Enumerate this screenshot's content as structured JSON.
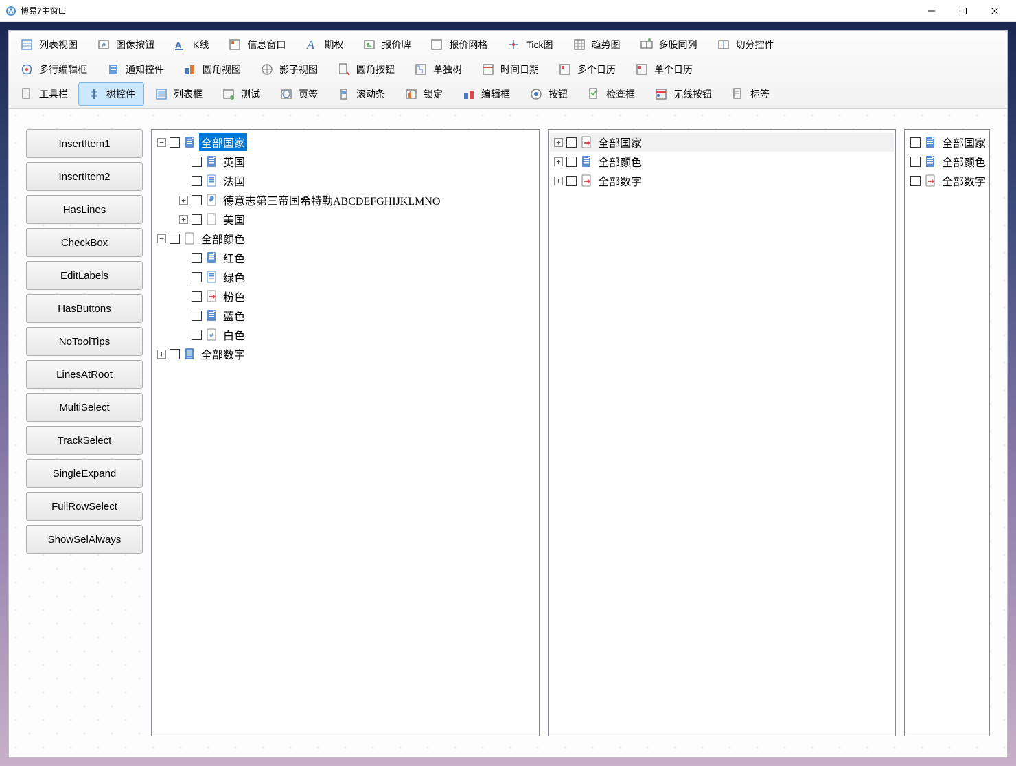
{
  "window": {
    "title": "博易7主窗口"
  },
  "toolbar_rows": [
    [
      "列表视图",
      "图像按钮",
      "K线",
      "信息窗口",
      "期权",
      "报价牌",
      "报价网格",
      "Tick图",
      "趋势图",
      "多股同列",
      "切分控件"
    ],
    [
      "多行编辑框",
      "通知控件",
      "圆角视图",
      "影子视图",
      "圆角按钮",
      "单独树",
      "时间日期",
      "多个日历",
      "单个日历"
    ],
    [
      "工具栏",
      "树控件",
      "列表框",
      "测试",
      "页签",
      "滚动条",
      "锁定",
      "编辑框",
      "按钮",
      "检查框",
      "无线按钮",
      "标签"
    ]
  ],
  "toolbar_active": "树控件",
  "side_buttons": [
    "InsertItem1",
    "InsertItem2",
    "HasLines",
    "CheckBox",
    "EditLabels",
    "HasButtons",
    "NoToolTips",
    "LinesAtRoot",
    "MultiSelect",
    "TrackSelect",
    "SingleExpand",
    "FullRowSelect",
    "ShowSelAlways"
  ],
  "tree1": [
    {
      "depth": 0,
      "exp": "-",
      "icon": "blue-doc",
      "label": "全部国家",
      "sel": true
    },
    {
      "depth": 1,
      "exp": "",
      "icon": "blue-doc",
      "label": "英国"
    },
    {
      "depth": 1,
      "exp": "",
      "icon": "list",
      "label": "法国"
    },
    {
      "depth": 1,
      "exp": "+",
      "icon": "tool",
      "label": "德意志第三帝国希特勒ABCDEFGHIJKLMNO"
    },
    {
      "depth": 1,
      "exp": "+",
      "icon": "page",
      "label": "美国"
    },
    {
      "depth": 0,
      "exp": "-",
      "icon": "page",
      "label": "全部颜色"
    },
    {
      "depth": 1,
      "exp": "",
      "icon": "blue-doc",
      "label": "红色"
    },
    {
      "depth": 1,
      "exp": "",
      "icon": "list",
      "label": "绿色"
    },
    {
      "depth": 1,
      "exp": "",
      "icon": "page-arrow",
      "label": "粉色"
    },
    {
      "depth": 1,
      "exp": "",
      "icon": "blue-doc",
      "label": "蓝色"
    },
    {
      "depth": 1,
      "exp": "",
      "icon": "hash",
      "label": "白色"
    },
    {
      "depth": 0,
      "exp": "+",
      "icon": "blue-lines",
      "label": "全部数字"
    }
  ],
  "tree2": [
    {
      "depth": 0,
      "exp": "+",
      "icon": "page-arrow",
      "label": "全部国家",
      "rowsel": true
    },
    {
      "depth": 0,
      "exp": "+",
      "icon": "blue-doc",
      "label": "全部颜色"
    },
    {
      "depth": 0,
      "exp": "+",
      "icon": "page-arrow",
      "label": "全部数字"
    }
  ],
  "tree3": [
    {
      "depth": 0,
      "exp": "",
      "icon": "blue-doc",
      "label": "全部国家"
    },
    {
      "depth": 0,
      "exp": "",
      "icon": "blue-doc",
      "label": "全部颜色"
    },
    {
      "depth": 0,
      "exp": "",
      "icon": "page-arrow",
      "label": "全部数字"
    }
  ]
}
